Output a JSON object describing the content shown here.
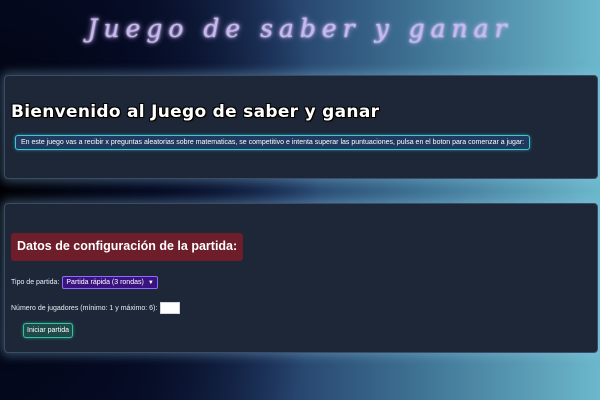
{
  "header": {
    "title": "Juego de saber y ganar"
  },
  "welcome": {
    "heading": "Bienvenido al Juego de saber y ganar",
    "intro": "En este juego vas a recibir x preguntas aleatorias sobre matematicas, se competitivo e intenta superar las puntuaciones, pulsa en el boton para comenzar a jugar:"
  },
  "config": {
    "heading": "Datos de configuración de la partida:",
    "game_type_label": "Tipo de partida:",
    "game_type_selected": "Partida rápida (3 rondas)",
    "players_label": "Número de jugadores (mínimo: 1 y máximo: 6):",
    "players_value": "",
    "start_button": "Iniciar partida"
  },
  "icons": {
    "select_arrow": "chevron-down-icon"
  },
  "colors": {
    "title_glow": "#c9a6ff",
    "card_bg": "#1d2738",
    "intro_border": "#3cc8d6",
    "config_heading_bg": "#6e1d2a",
    "select_bg": "#3a1380",
    "button_border": "#33c2a0"
  }
}
